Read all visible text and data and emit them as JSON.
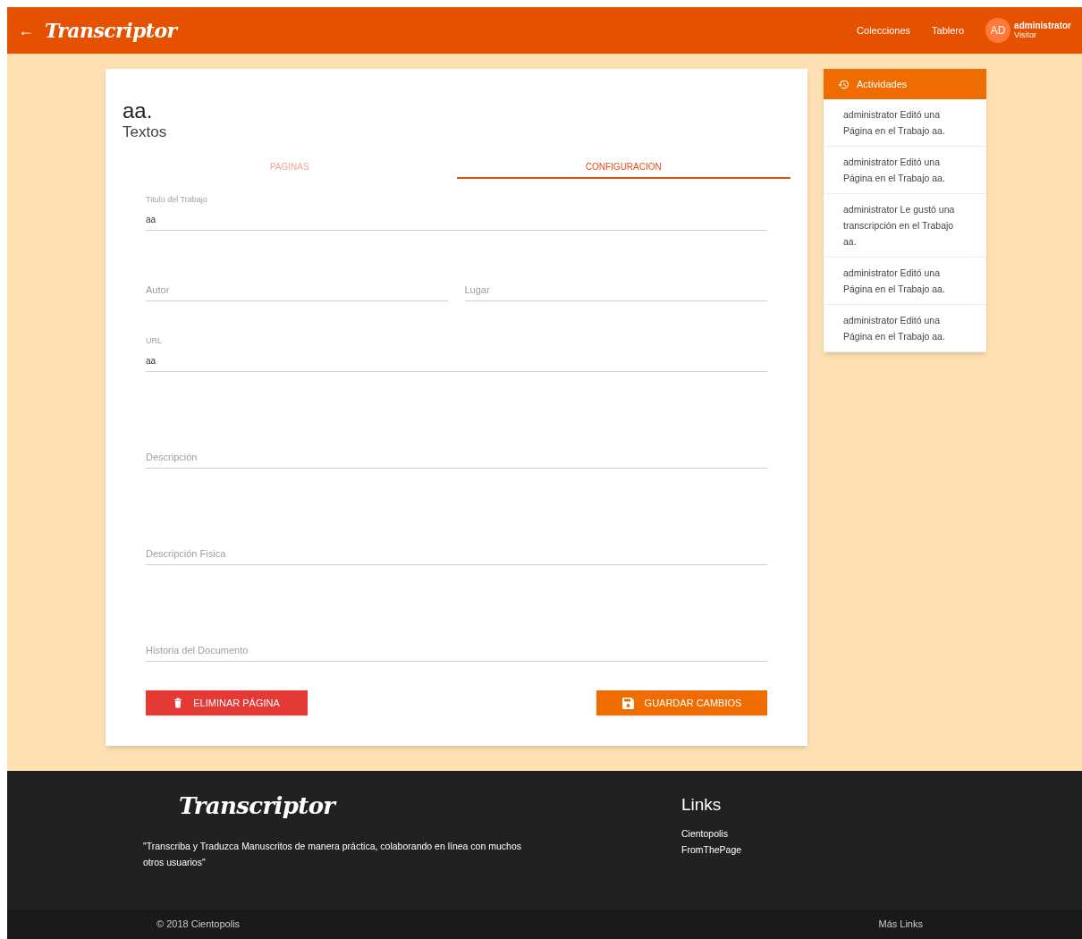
{
  "header": {
    "back": "←",
    "logo": "Transcriptor",
    "nav": [
      "Colecciones",
      "Tablero"
    ],
    "avatar": "AD",
    "user": "administrator",
    "role": "Visitor"
  },
  "card": {
    "title": "aa.",
    "subtitle": "Textos",
    "tabs": [
      {
        "label": "PAGINAS",
        "selected": false
      },
      {
        "label": "CONFIGURACION",
        "selected": true
      }
    ],
    "fields": [
      {
        "label": "Titulo del Trabajo",
        "value": "aa",
        "kind": "full"
      },
      {
        "placeholder": "Autor",
        "kind": "half"
      },
      {
        "placeholder": "Lugar",
        "kind": "half"
      },
      {
        "label": "URL",
        "value": "aa",
        "kind": "full"
      },
      {
        "placeholder": "Descripción",
        "kind": "full"
      },
      {
        "placeholder": "Descripción Fisica",
        "kind": "full"
      },
      {
        "placeholder": "Historia del Documento",
        "kind": "full"
      }
    ],
    "delete_button": "ELIMINAR PÁGINA",
    "save_button": "GUARDAR CAMBIOS"
  },
  "activities": {
    "title": "Actividades",
    "items": [
      "administrator Editó una Página en el Trabajo aa.",
      "administrator Editó una Página en el Trabajo aa.",
      "administrator Le gustó una transcripción en el Trabajo aa.",
      "administrator Editó una Página en el Trabajo aa.",
      "administrator Editó una Página en el Trabajo aa."
    ]
  },
  "footer": {
    "logo": "Transcriptor",
    "tagline": "\"Transcriba y Traduzca Manuscritos de manera práctica, colaborando en línea con muchos otros usuarios\"",
    "links_title": "Links",
    "links": [
      "Cientopolis",
      "FromThePage"
    ],
    "copyright": "© 2018 Cientopolis",
    "more_links": "Más Links"
  }
}
